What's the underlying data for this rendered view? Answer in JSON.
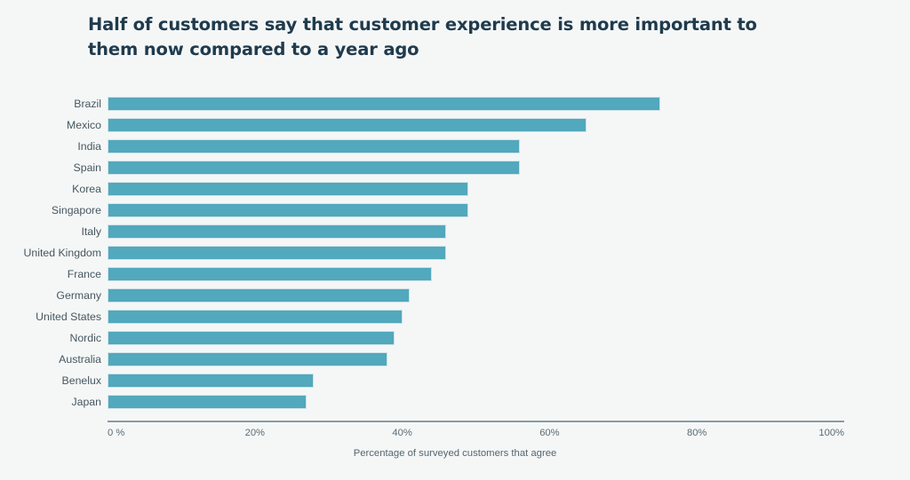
{
  "chart_data": {
    "type": "bar",
    "orientation": "horizontal",
    "title": "Half of customers say that customer experience is more important to them now compared to a year ago",
    "xlabel": "Percentage of surveyed customers that agree",
    "ylabel": "",
    "xlim": [
      0,
      100
    ],
    "grid": false,
    "legend": null,
    "bar_color": "#52a8bc",
    "categories": [
      "Brazil",
      "Mexico",
      "India",
      "Spain",
      "Korea",
      "Singapore",
      "Italy",
      "United Kingdom",
      "France",
      "Germany",
      "United States",
      "Nordic",
      "Australia",
      "Benelux",
      "Japan"
    ],
    "values": [
      75,
      65,
      56,
      56,
      49,
      49,
      46,
      46,
      44,
      41,
      40,
      39,
      38,
      28,
      27
    ],
    "xticks": [
      0,
      20,
      40,
      60,
      80,
      100
    ],
    "xtick_labels": [
      "0 %",
      "20%",
      "40%",
      "60%",
      "80%",
      "100%"
    ]
  },
  "style": {
    "background": "#f5f7f7",
    "title_color": "#1f3b4d",
    "label_color": "#46575f",
    "axis_color": "#8b9aa3"
  }
}
